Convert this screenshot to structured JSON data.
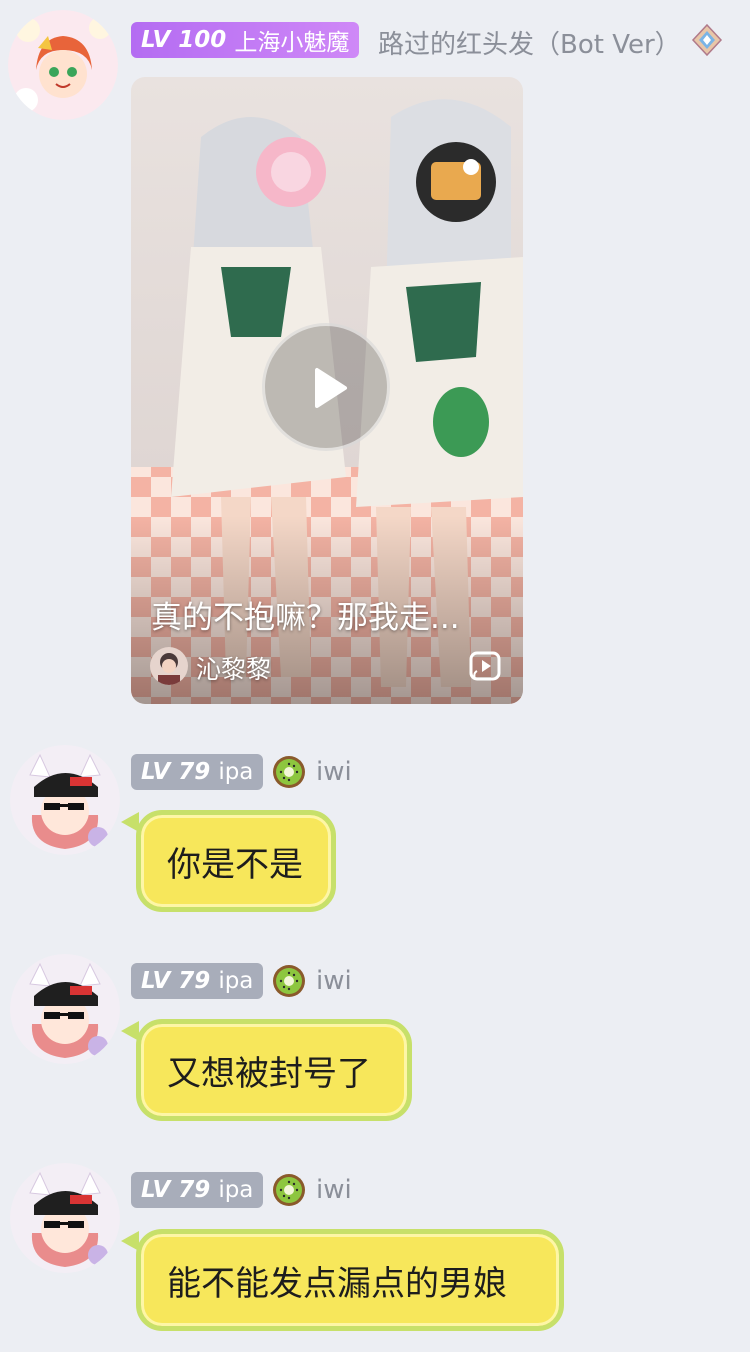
{
  "messages": [
    {
      "sender": {
        "level": "LV 100",
        "title": "上海小魅魔",
        "name": "路过的红头发（Bot Ver）",
        "role_icon": "diamond-gem-icon"
      },
      "video": {
        "title": "真的不抱嘛？那我走...",
        "author": "沁黎黎",
        "play_icon": "play-icon",
        "platform_icon": "video-platform-icon"
      }
    },
    {
      "sender": {
        "level": "LV 79",
        "title": "ipa",
        "name": "iwi",
        "title_icon": "kiwi-icon"
      },
      "text": "你是不是"
    },
    {
      "sender": {
        "level": "LV 79",
        "title": "ipa",
        "name": "iwi",
        "title_icon": "kiwi-icon"
      },
      "text": "又想被封号了"
    },
    {
      "sender": {
        "level": "LV 79",
        "title": "ipa",
        "name": "iwi",
        "title_icon": "kiwi-icon"
      },
      "text": "能不能发点漏点的男娘"
    }
  ],
  "colors": {
    "background": "#eceef3",
    "bubble_fill": "#f7e75b",
    "bubble_border": "#c7e06a",
    "badge_purple": "#b46cf2",
    "badge_gray": "#a8adba",
    "name_gray": "#8b8f99"
  }
}
